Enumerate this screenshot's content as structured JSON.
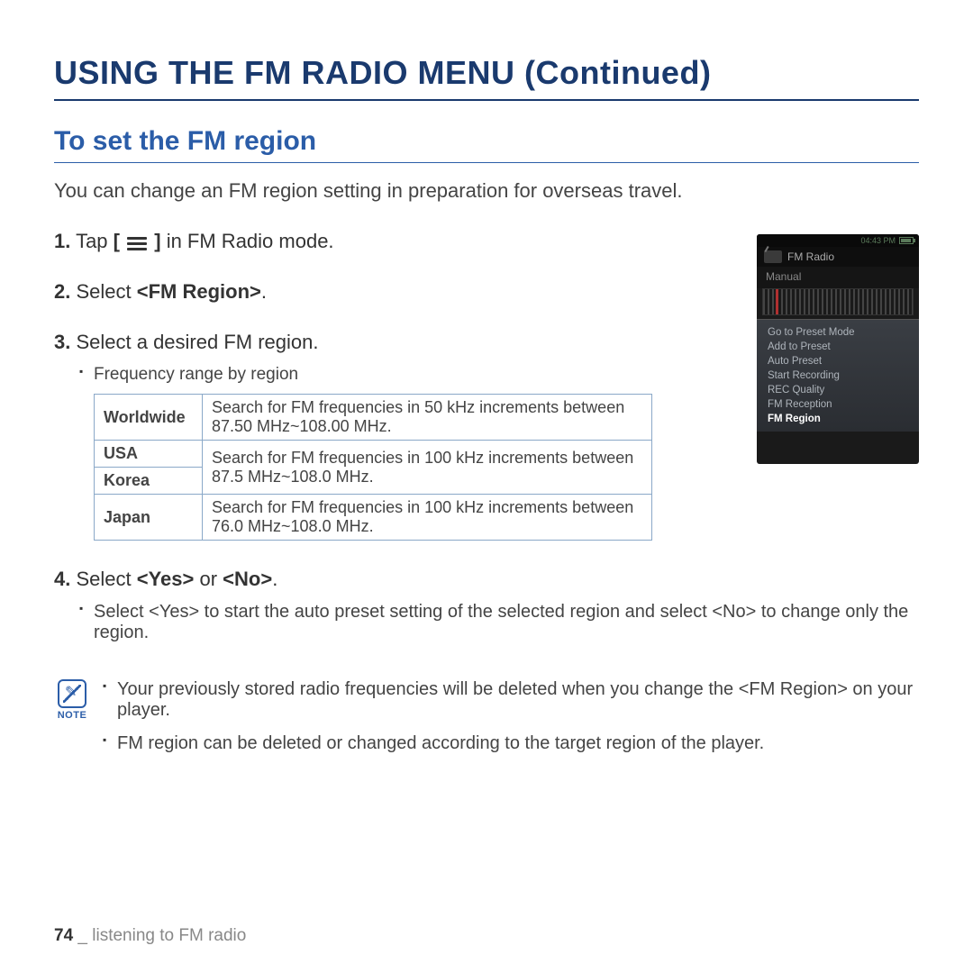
{
  "page_title": "USING THE FM RADIO MENU (Continued)",
  "section_heading": "To set the FM region",
  "intro": "You can change an FM region setting in preparation for overseas travel.",
  "steps": {
    "s1_num": "1.",
    "s1_a": " Tap ",
    "s1_b": "[ ",
    "s1_c": " ]",
    "s1_d": " in FM Radio mode.",
    "s2_num": "2.",
    "s2_text_a": " Select ",
    "s2_bold": "<FM Region>",
    "s2_text_b": ".",
    "s3_num": "3.",
    "s3_text": " Select a desired FM region.",
    "s3_sub": "Frequency range by region",
    "s4_num": "4.",
    "s4_text_a": " Select ",
    "s4_bold": "<Yes>",
    "s4_text_b": " or ",
    "s4_bold2": "<No>",
    "s4_text_c": ".",
    "s4_sub": "Select <Yes> to start the auto preset setting of the selected region and select <No> to change only the region."
  },
  "table": {
    "r1_region": "Worldwide",
    "r1_desc": "Search for FM frequencies in 50 kHz increments between 87.50 MHz~108.00 MHz.",
    "r2_region": "USA",
    "r3_region": "Korea",
    "r23_desc": "Search for FM frequencies in 100 kHz increments between 87.5 MHz~108.0 MHz.",
    "r4_region": "Japan",
    "r4_desc": "Search for FM frequencies in 100 kHz increments between 76.0 MHz~108.0 MHz."
  },
  "note": {
    "label": "NOTE",
    "n1": "Your previously stored radio frequencies will be deleted when you change the <FM Region> on your player.",
    "n2": "FM region can be deleted or changed according to the target region of the player."
  },
  "footer": {
    "page_num": "74",
    "sep": " _ ",
    "chapter": "listening to FM radio"
  },
  "device": {
    "time": "04:43 PM",
    "title": "FM Radio",
    "mode": "Manual",
    "menu": [
      "Go to Preset Mode",
      "Add to Preset",
      "Auto Preset",
      "Start Recording",
      "REC Quality",
      "FM Reception",
      "FM Region"
    ]
  }
}
